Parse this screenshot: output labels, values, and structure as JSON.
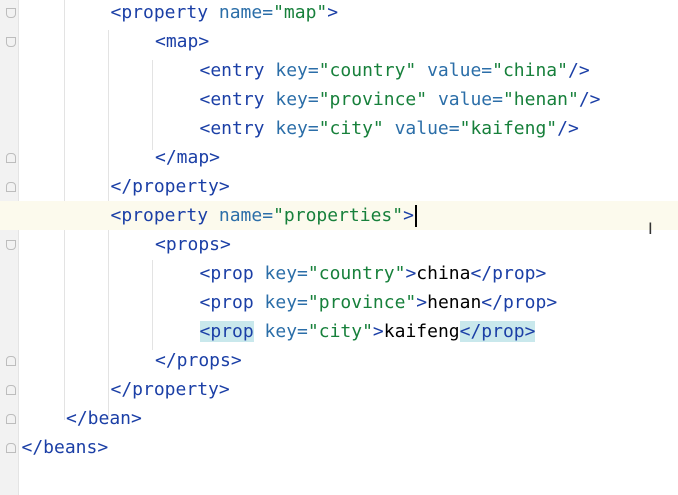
{
  "editor": {
    "lines": [
      {
        "indent": 1,
        "fold": "open",
        "tokens": [
          [
            "tag",
            "<property "
          ],
          [
            "attr",
            "name="
          ],
          [
            "val",
            "\"map\""
          ],
          [
            "tag",
            ">"
          ]
        ]
      },
      {
        "indent": 2,
        "fold": "open",
        "tokens": [
          [
            "tag",
            "<map>"
          ]
        ]
      },
      {
        "indent": 3,
        "fold": "",
        "tokens": [
          [
            "tag",
            "<entry "
          ],
          [
            "attr",
            "key="
          ],
          [
            "val",
            "\"country\" "
          ],
          [
            "attr",
            "value="
          ],
          [
            "val",
            "\"china\""
          ],
          [
            "tag",
            "/>"
          ]
        ]
      },
      {
        "indent": 3,
        "fold": "",
        "tokens": [
          [
            "tag",
            "<entry "
          ],
          [
            "attr",
            "key="
          ],
          [
            "val",
            "\"province\" "
          ],
          [
            "attr",
            "value="
          ],
          [
            "val",
            "\"henan\""
          ],
          [
            "tag",
            "/>"
          ]
        ]
      },
      {
        "indent": 3,
        "fold": "",
        "tokens": [
          [
            "tag",
            "<entry "
          ],
          [
            "attr",
            "key="
          ],
          [
            "val",
            "\"city\" "
          ],
          [
            "attr",
            "value="
          ],
          [
            "val",
            "\"kaifeng\""
          ],
          [
            "tag",
            "/>"
          ]
        ]
      },
      {
        "indent": 2,
        "fold": "close",
        "tokens": [
          [
            "tag",
            "</map>"
          ]
        ]
      },
      {
        "indent": 1,
        "fold": "close",
        "tokens": [
          [
            "tag",
            "</property>"
          ]
        ]
      },
      {
        "indent": 1,
        "fold": "open",
        "current": true,
        "caret": true,
        "tokens": [
          [
            "tag",
            "<property "
          ],
          [
            "attr",
            "name="
          ],
          [
            "val",
            "\"properties\""
          ],
          [
            "tag",
            ">"
          ]
        ]
      },
      {
        "indent": 2,
        "fold": "open",
        "tokens": [
          [
            "tag",
            "<props>"
          ]
        ]
      },
      {
        "indent": 3,
        "fold": "",
        "tokens": [
          [
            "tag",
            "<prop "
          ],
          [
            "attr",
            "key="
          ],
          [
            "val",
            "\"country\""
          ],
          [
            "tag",
            ">"
          ],
          [
            "txt",
            "china"
          ],
          [
            "tag",
            "</prop>"
          ]
        ]
      },
      {
        "indent": 3,
        "fold": "",
        "tokens": [
          [
            "tag",
            "<prop "
          ],
          [
            "attr",
            "key="
          ],
          [
            "val",
            "\"province\""
          ],
          [
            "tag",
            ">"
          ],
          [
            "txt",
            "henan"
          ],
          [
            "tag",
            "</prop>"
          ]
        ]
      },
      {
        "indent": 3,
        "fold": "",
        "tokens": [
          [
            "hltag",
            "<prop"
          ],
          [
            "tag",
            " "
          ],
          [
            "attr",
            "key="
          ],
          [
            "val",
            "\"city\""
          ],
          [
            "tag",
            ">"
          ],
          [
            "txt",
            "kaifeng"
          ],
          [
            "hltag",
            "</prop>"
          ]
        ]
      },
      {
        "indent": 2,
        "fold": "close",
        "tokens": [
          [
            "tag",
            "</props>"
          ]
        ]
      },
      {
        "indent": 1,
        "fold": "close",
        "tokens": [
          [
            "tag",
            "</property>"
          ]
        ]
      },
      {
        "indent": 0,
        "fold": "close",
        "tokens": [
          [
            "tag",
            "</bean>"
          ]
        ]
      },
      {
        "indent": -1,
        "fold": "close",
        "tokens": [
          [
            "tag",
            "</beans>"
          ]
        ]
      }
    ]
  },
  "mouse_cursor": "text-cursor-icon"
}
